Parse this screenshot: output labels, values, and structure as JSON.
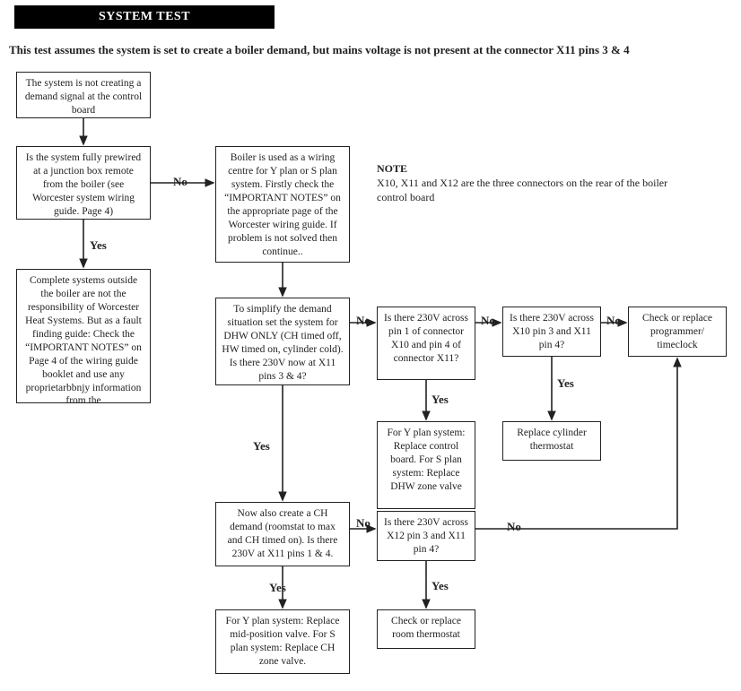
{
  "header": {
    "title": "SYSTEM TEST"
  },
  "intro": "This test assumes the system is set to create a boiler demand, but mains voltage is not present at the connector X11 pins 3 & 4",
  "note": {
    "title": "NOTE",
    "body": "X10, X11 and X12 are the three connectors on the rear of the boiler control board"
  },
  "boxes": {
    "b1": "The system is not creating a demand signal at the control board",
    "b2": "Is the system fully prewired at a junction box remote from the boiler (see Worcester system wiring guide. Page 4)",
    "b3": "Complete systems outside the boiler are not the responsibility of Worcester Heat Systems. But as a fault finding guide: Check the “IMPORTANT NOTES” on Page 4 of the wiring guide booklet and use any proprietarbbnjy information from the",
    "b4": "Boiler is used as a wiring centre for Y plan or S plan system. Firstly check the “IMPORTANT NOTES” on the appropriate page of the Worcester wiring guide. If problem is not solved then continue..",
    "b5": "To simplify the demand situation set the system for DHW ONLY (CH timed off, HW timed on, cylinder cold). Is there 230V now at X11 pins 3 & 4?",
    "b6": "Is there 230V across pin 1 of connector X10 and pin 4 of connector X11?",
    "b7": "Is there 230V across X10 pin 3 and X11 pin 4?",
    "b8": "Check or replace programmer/ timeclock",
    "b9": "For Y plan system: Replace control board. For S plan system: Replace DHW zone valve",
    "b10": "Replace cylinder thermostat",
    "b11": "Now also create a CH demand (roomstat to max and CH timed on). Is there 230V at X11 pins 1 & 4.",
    "b12": "Is there 230V across X12 pin 3 and X11 pin 4?",
    "b13": "For Y plan system: Replace mid-position valve. For S plan system: Replace CH zone valve.",
    "b14": "Check or replace room thermostat"
  },
  "labels": {
    "yes": "Yes",
    "no": "No"
  },
  "chart_data": {
    "type": "flowchart",
    "title": "SYSTEM TEST",
    "assumption": "System set to create a boiler demand, mains voltage not present at connector X11 pins 3 & 4",
    "nodes": [
      {
        "id": "b1",
        "kind": "start",
        "text": "The system is not creating a demand signal at the control board"
      },
      {
        "id": "b2",
        "kind": "decision",
        "text": "Is the system fully prewired at a junction box remote from the boiler (see Worcester system wiring guide. Page 4)"
      },
      {
        "id": "b3",
        "kind": "process",
        "text": "Complete systems outside the boiler are not the responsibility of Worcester Heat Systems. Fault-finding guide: check IMPORTANT NOTES on Page 4 of wiring guide booklet and use any proprietary information."
      },
      {
        "id": "b4",
        "kind": "process",
        "text": "Boiler is used as a wiring centre for Y plan or S plan system. Firstly check IMPORTANT NOTES on the appropriate page of the Worcester wiring guide. If problem is not solved then continue."
      },
      {
        "id": "b5",
        "kind": "decision",
        "text": "Set system for DHW ONLY (CH timed off, HW timed on, cylinder cold). Is there 230V now at X11 pins 3 & 4?"
      },
      {
        "id": "b6",
        "kind": "decision",
        "text": "Is there 230V across pin 1 of connector X10 and pin 4 of connector X11?"
      },
      {
        "id": "b7",
        "kind": "decision",
        "text": "Is there 230V across X10 pin 3 and X11 pin 4?"
      },
      {
        "id": "b8",
        "kind": "terminal",
        "text": "Check or replace programmer / timeclock"
      },
      {
        "id": "b9",
        "kind": "terminal",
        "text": "For Y plan system: Replace control board. For S plan system: Replace DHW zone valve"
      },
      {
        "id": "b10",
        "kind": "terminal",
        "text": "Replace cylinder thermostat"
      },
      {
        "id": "b11",
        "kind": "decision",
        "text": "Now also create a CH demand (roomstat to max and CH timed on). Is there 230V at X11 pins 1 & 4?"
      },
      {
        "id": "b12",
        "kind": "decision",
        "text": "Is there 230V across X12 pin 3 and X11 pin 4?"
      },
      {
        "id": "b13",
        "kind": "terminal",
        "text": "For Y plan system: Replace mid-position valve. For S plan system: Replace CH zone valve."
      },
      {
        "id": "b14",
        "kind": "terminal",
        "text": "Check or replace room thermostat"
      }
    ],
    "edges": [
      {
        "from": "b1",
        "to": "b2",
        "label": ""
      },
      {
        "from": "b2",
        "to": "b3",
        "label": "Yes"
      },
      {
        "from": "b2",
        "to": "b4",
        "label": "No"
      },
      {
        "from": "b4",
        "to": "b5",
        "label": ""
      },
      {
        "from": "b5",
        "to": "b11",
        "label": "Yes"
      },
      {
        "from": "b5",
        "to": "b6",
        "label": "No"
      },
      {
        "from": "b6",
        "to": "b9",
        "label": "Yes"
      },
      {
        "from": "b6",
        "to": "b7",
        "label": "No"
      },
      {
        "from": "b7",
        "to": "b10",
        "label": "Yes"
      },
      {
        "from": "b7",
        "to": "b8",
        "label": "No"
      },
      {
        "from": "b11",
        "to": "b13",
        "label": "Yes"
      },
      {
        "from": "b11",
        "to": "b12",
        "label": "No"
      },
      {
        "from": "b12",
        "to": "b14",
        "label": "Yes"
      },
      {
        "from": "b12",
        "to": "b8",
        "label": "No"
      }
    ]
  }
}
